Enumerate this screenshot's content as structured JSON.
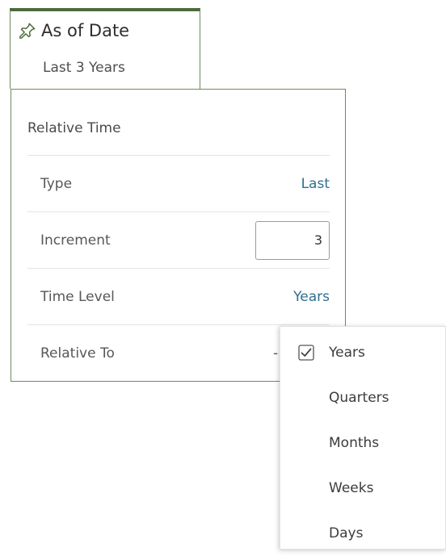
{
  "filter": {
    "title": "As of Date",
    "subtitle": "Last 3 Years",
    "pin_icon": "pin-icon",
    "accent_color": "#4c6b3c"
  },
  "panel": {
    "section_title": "Relative Time",
    "rows": {
      "type": {
        "label": "Type",
        "value": "Last"
      },
      "increment": {
        "label": "Increment",
        "value": "3"
      },
      "time_level": {
        "label": "Time Level",
        "value": "Years"
      },
      "relative_to": {
        "label": "Relative To",
        "value": "-"
      }
    },
    "link_color": "#2f6f8f"
  },
  "dropdown": {
    "items": [
      {
        "label": "Years",
        "checked": true
      },
      {
        "label": "Quarters",
        "checked": false
      },
      {
        "label": "Months",
        "checked": false
      },
      {
        "label": "Weeks",
        "checked": false
      },
      {
        "label": "Days",
        "checked": false
      }
    ],
    "check_icon": "check-icon"
  }
}
